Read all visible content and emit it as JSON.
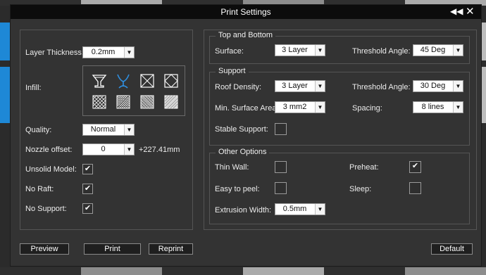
{
  "window": {
    "title": "Print Settings"
  },
  "left": {
    "layer_thickness": {
      "label": "Layer Thickness:",
      "value": "0.2mm"
    },
    "infill": {
      "label": "Infill:"
    },
    "quality": {
      "label": "Quality:",
      "value": "Normal"
    },
    "nozzle_offset": {
      "label": "Nozzle offset:",
      "value": "0",
      "readout": "+227.41mm"
    },
    "unsolid_model": {
      "label": "Unsolid Model:",
      "checked": true
    },
    "no_raft": {
      "label": "No Raft:",
      "checked": true
    },
    "no_support": {
      "label": "No Support:",
      "checked": true
    }
  },
  "top_bottom": {
    "title": "Top and Bottom",
    "surface": {
      "label": "Surface:",
      "value": "3 Layer"
    },
    "threshold": {
      "label": "Threshold Angle:",
      "value": "45 Deg"
    }
  },
  "support": {
    "title": "Support",
    "roof_density": {
      "label": "Roof Density:",
      "value": "3 Layer"
    },
    "threshold": {
      "label": "Threshold Angle:",
      "value": "30 Deg"
    },
    "min_surface": {
      "label": "Min. Surface Area:",
      "value": "3 mm2"
    },
    "spacing": {
      "label": "Spacing:",
      "value": "8 lines"
    },
    "stable": {
      "label": "Stable Support:",
      "checked": false
    }
  },
  "other": {
    "title": "Other Options",
    "thin_wall": {
      "label": "Thin Wall:",
      "checked": false
    },
    "preheat": {
      "label": "Preheat:",
      "checked": true
    },
    "easy_peel": {
      "label": "Easy to peel:",
      "checked": false
    },
    "sleep": {
      "label": "Sleep:",
      "checked": false
    },
    "extrusion_width": {
      "label": "Extrusion Width:",
      "value": "0.5mm"
    }
  },
  "buttons": {
    "preview": "Preview",
    "print": "Print",
    "reprint": "Reprint",
    "default": "Default"
  },
  "glyphs": {
    "check": "✔",
    "arrow": "▼",
    "collapse": "◀◀",
    "close": "✕"
  },
  "icons": [
    "goblet-outline-icon",
    "goblet-blue-icon",
    "hollow-cross-box-icon",
    "diamond-box-icon",
    "grid-coarse-icon",
    "grid-medium-icon",
    "grid-fine-icon",
    "solid-fill-icon"
  ],
  "colors": {
    "accent": "#1e88d6",
    "panel_bg": "#333333",
    "titlebar_bg": "#0c0c0c"
  }
}
